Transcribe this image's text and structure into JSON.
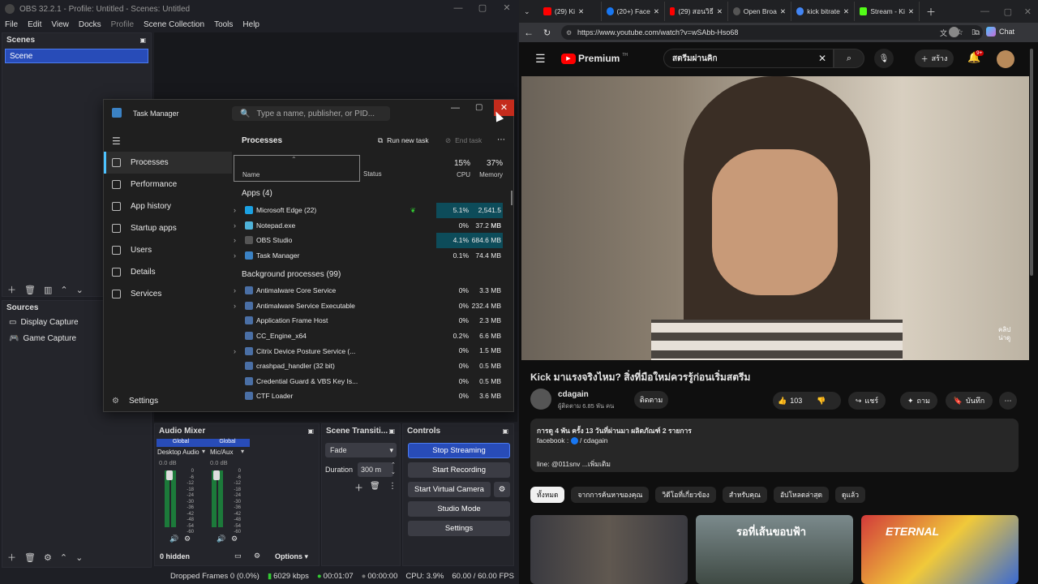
{
  "obs": {
    "title": "OBS 32.2.1 - Profile: Untitled - Scenes: Untitled",
    "menu": [
      "File",
      "Edit",
      "View",
      "Docks",
      "Profile",
      "Scene Collection",
      "Tools",
      "Help"
    ],
    "scenes_title": "Scenes",
    "scenes": [
      "Scene"
    ],
    "sources_title": "Sources",
    "sources": [
      "Display Capture",
      "Game Capture"
    ],
    "audio_title": "Audio Mixer",
    "audio_channels": [
      {
        "name": "Desktop Audio",
        "db": "0.0 dB",
        "scope": "Global"
      },
      {
        "name": "Mic/Aux",
        "db": "0.0 dB",
        "scope": "Global"
      }
    ],
    "meter_ticks": [
      "0",
      "-6",
      "-12",
      "-18",
      "-24",
      "-30",
      "-36",
      "-42",
      "-48",
      "-54",
      "-60"
    ],
    "hidden_label": "0 hidden",
    "options_label": "Options",
    "transitions_title": "Scene Transiti...",
    "transition_value": "Fade",
    "duration_label": "Duration",
    "duration_value": "300 m",
    "controls_title": "Controls",
    "controls": {
      "stream": "Stop Streaming",
      "record": "Start Recording",
      "vcam": "Start Virtual Camera",
      "studio": "Studio Mode",
      "settings": "Settings"
    },
    "status": {
      "dropped": "Dropped Frames 0 (0.0%)",
      "kbps": "6029 kbps",
      "live_time": "00:01:07",
      "rec_time": "00:00:00",
      "cpu": "CPU: 3.9%",
      "fps": "60.00 / 60.00 FPS"
    }
  },
  "tm": {
    "title": "Task Manager",
    "search_placeholder": "Type a name, publisher, or PID...",
    "nav": [
      "Processes",
      "Performance",
      "App history",
      "Startup apps",
      "Users",
      "Details",
      "Services"
    ],
    "settings": "Settings",
    "page_title": "Processes",
    "run_task": "Run new task",
    "end_task": "End task",
    "col_name": "Name",
    "col_status": "Status",
    "cpu_pct": "15%",
    "cpu_label": "CPU",
    "mem_pct": "37%",
    "mem_label": "Memory",
    "apps_group": "Apps (4)",
    "bg_group": "Background processes (99)",
    "apps": [
      {
        "name": "Microsoft Edge (22)",
        "cpu": "5.1%",
        "mem": "2,541.5 MB",
        "exp": true,
        "color": "#1ba1e2"
      },
      {
        "name": "Notepad.exe",
        "cpu": "0%",
        "mem": "37.2 MB",
        "exp": true,
        "color": "#4fb3d9"
      },
      {
        "name": "OBS Studio",
        "cpu": "4.1%",
        "mem": "684.6 MB",
        "exp": true,
        "color": "#555555"
      },
      {
        "name": "Task Manager",
        "cpu": "0.1%",
        "mem": "74.4 MB",
        "exp": true,
        "color": "#3b82c4"
      }
    ],
    "bg": [
      {
        "name": "Antimalware Core Service",
        "cpu": "0%",
        "mem": "3.3 MB",
        "exp": true
      },
      {
        "name": "Antimalware Service Executable",
        "cpu": "0%",
        "mem": "232.4 MB",
        "exp": true
      },
      {
        "name": "Application Frame Host",
        "cpu": "0%",
        "mem": "2.3 MB",
        "exp": false
      },
      {
        "name": "CC_Engine_x64",
        "cpu": "0.2%",
        "mem": "6.6 MB",
        "exp": false
      },
      {
        "name": "Citrix Device Posture Service (...",
        "cpu": "0%",
        "mem": "1.5 MB",
        "exp": true
      },
      {
        "name": "crashpad_handler (32 bit)",
        "cpu": "0%",
        "mem": "0.5 MB",
        "exp": false
      },
      {
        "name": "Credential Guard & VBS Key Is...",
        "cpu": "0%",
        "mem": "0.5 MB",
        "exp": false
      },
      {
        "name": "CTF Loader",
        "cpu": "0%",
        "mem": "3.6 MB",
        "exp": false
      }
    ]
  },
  "chrome": {
    "tabs": [
      "(29) Ki",
      "(20+) Face",
      "(29) สอนวิธี",
      "Open Broa",
      "kick bitrate",
      "Stream - Ki"
    ],
    "url": "https://www.youtube.com/watch?v=wSAbb-Hso68",
    "chat": "Chat"
  },
  "yt": {
    "logo": "Premium",
    "logo_sup": "TH",
    "search": "สตรีมผ่านคิก",
    "create": "สร้าง",
    "notif": "9+",
    "overlay": "คลิป\nน่าดู",
    "video_title": "Kick มาแรงจริงไหม? สิ่งที่มือใหม่ควรรู้ก่อนเริ่มสตรีม",
    "channel": "cdagain",
    "subs": "ผู้ติดตาม 6.85 พัน คน",
    "subscribe": "ติดตาม",
    "likes": "103",
    "share": "แชร์",
    "ask": "ถาม",
    "save": "บันทึก",
    "desc_meta": "การดู 4 พัน ครั้ง  13 วันที่ผ่านมา  ผลิตภัณฑ์ 2 รายการ",
    "desc_fb": "facebook : ",
    "desc_fb_link": " / cdagain",
    "desc_line": "line: @011snv",
    "desc_more": "...เพิ่มเติม",
    "chips": [
      "ทั้งหมด",
      "จากการค้นหาของคุณ",
      "วิดีโอที่เกี่ยวข้อง",
      "สำหรับคุณ",
      "อัปโหลดล่าสุด",
      "ดูแล้ว"
    ],
    "thumb2_text": "รอที่เส้นขอบฟ้า",
    "thumb3_text": "ETERNAL"
  }
}
